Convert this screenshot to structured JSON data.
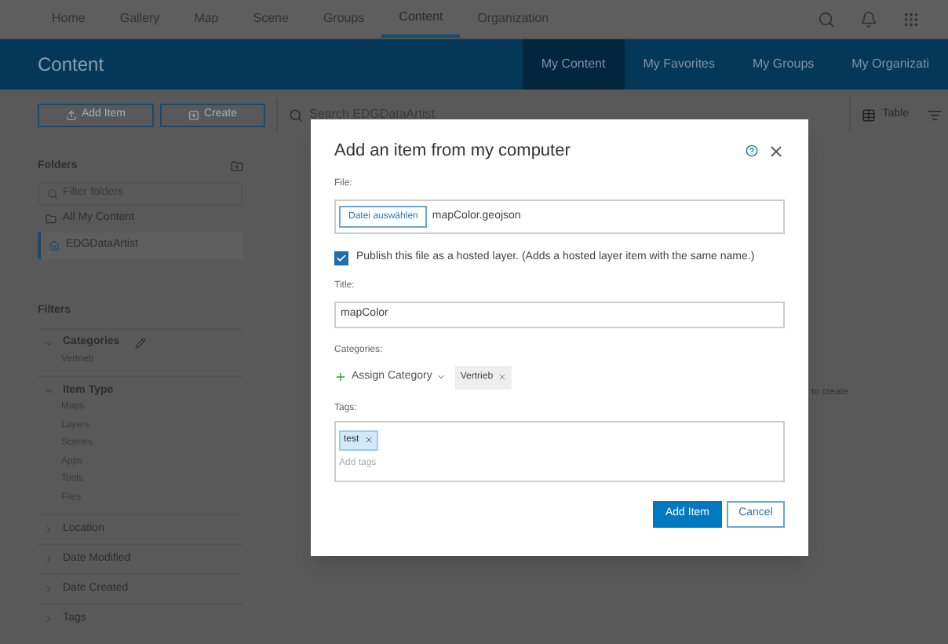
{
  "nav": {
    "items": [
      {
        "label": "Home",
        "selected": false
      },
      {
        "label": "Gallery",
        "selected": false
      },
      {
        "label": "Map",
        "selected": false
      },
      {
        "label": "Scene",
        "selected": false
      },
      {
        "label": "Groups",
        "selected": false
      },
      {
        "label": "Content",
        "selected": true
      },
      {
        "label": "Organization",
        "selected": false
      }
    ]
  },
  "header": {
    "title": "Content",
    "tabs": [
      {
        "label": "My Content",
        "selected": true
      },
      {
        "label": "My Favorites",
        "selected": false
      },
      {
        "label": "My Groups",
        "selected": false
      },
      {
        "label": "My Organizati",
        "selected": false
      }
    ]
  },
  "toolbar": {
    "add_item": "Add Item",
    "create": "Create",
    "search_placeholder": "Search EDGDataArtist",
    "view": "Table"
  },
  "sidebar": {
    "folders_title": "Folders",
    "filter_placeholder": "Filter folders",
    "folders": [
      {
        "label": "All My Content",
        "kind": "all",
        "selected": false
      },
      {
        "label": "EDGDataArtist",
        "kind": "home",
        "selected": true
      }
    ],
    "filters_title": "Filters",
    "groups": [
      {
        "label": "Categories",
        "expanded": true,
        "editable": true,
        "items": [
          "Vertrieb"
        ]
      },
      {
        "label": "Item Type",
        "expanded": true,
        "editable": false,
        "items": [
          "Maps",
          "Layers",
          "Scenes",
          "Apps",
          "Tools",
          "Files"
        ]
      },
      {
        "label": "Location",
        "expanded": false,
        "editable": false
      },
      {
        "label": "Date Modified",
        "expanded": false,
        "editable": false
      },
      {
        "label": "Date Created",
        "expanded": false,
        "editable": false
      },
      {
        "label": "Tags",
        "expanded": false,
        "editable": false
      }
    ]
  },
  "background_text": "to create",
  "dialog": {
    "title": "Add an item from my computer",
    "file_label": "File:",
    "file_button": "Datei auswählen",
    "file_name": "mapColor.geojson",
    "publish": {
      "checked": true,
      "label": "Publish this file as a hosted layer. (Adds a hosted layer item with the same name.)"
    },
    "title_label": "Title:",
    "title_value": "mapColor",
    "categories_label": "Categories:",
    "assign_label": "Assign Category",
    "categories": [
      "Vertrieb"
    ],
    "tags_label": "Tags:",
    "tags": [
      "test"
    ],
    "tags_placeholder": "Add tags",
    "primary": "Add Item",
    "secondary": "Cancel"
  }
}
